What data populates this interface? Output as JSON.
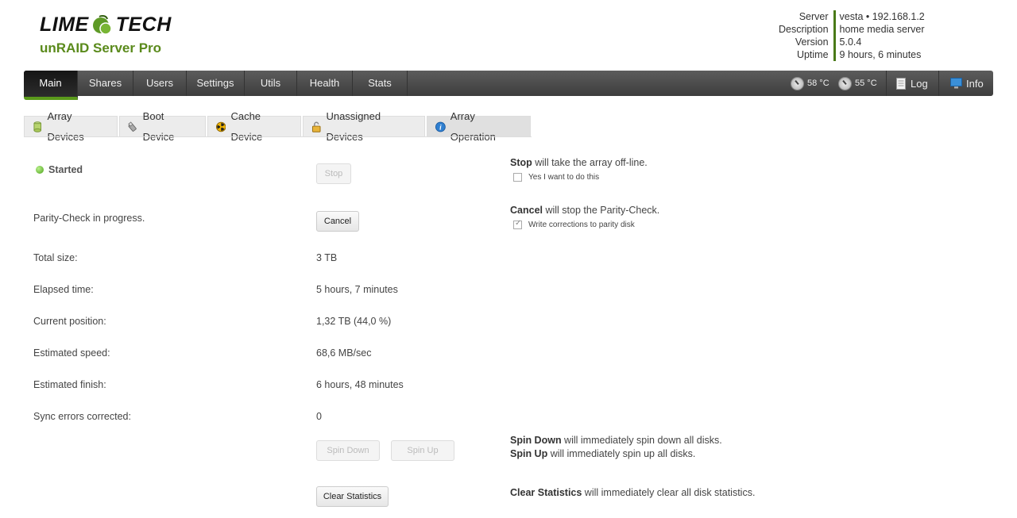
{
  "header": {
    "logo_left": "LIME",
    "logo_right": "TECH",
    "product": "unRAID Server Pro"
  },
  "server_info": {
    "labels": [
      "Server",
      "Description",
      "Version",
      "Uptime"
    ],
    "values": [
      "vesta • 192.168.1.2",
      "home media server",
      "5.0.4",
      "9 hours, 6 minutes"
    ]
  },
  "nav": {
    "items": [
      "Main",
      "Shares",
      "Users",
      "Settings",
      "Utils",
      "Health",
      "Stats"
    ],
    "temp1": "58 °C",
    "temp2": "55 °C",
    "log": "Log",
    "info": "Info"
  },
  "tabs": [
    "Array Devices",
    "Boot Device",
    "Cache Device",
    "Unassigned Devices",
    "Array Operation"
  ],
  "status": "Started",
  "stop_button": "Stop",
  "stop_desc_bold": "Stop",
  "stop_desc_rest": " will take the array off-line.",
  "stop_confirm": "Yes I want to do this",
  "parity_text": "Parity-Check in progress.",
  "cancel_button": "Cancel",
  "cancel_desc_bold": "Cancel",
  "cancel_desc_rest": " will stop the Parity-Check.",
  "write_corrections": "Write corrections to parity disk",
  "stats": {
    "total_size_label": "Total size:",
    "total_size": "3 TB",
    "elapsed_label": "Elapsed time:",
    "elapsed": "5 hours, 7 minutes",
    "position_label": "Current position:",
    "position": "1,32 TB (44,0 %)",
    "speed_label": "Estimated speed:",
    "speed": "68,6 MB/sec",
    "finish_label": "Estimated finish:",
    "finish": "6 hours, 48 minutes",
    "sync_label": "Sync errors corrected:",
    "sync": "0"
  },
  "spin_down_button": "Spin Down",
  "spin_up_button": "Spin Up",
  "spin_down_bold": "Spin Down",
  "spin_down_rest": " will immediately spin down all disks.",
  "spin_up_bold": "Spin Up",
  "spin_up_rest": " will immediately spin up all disks.",
  "clear_button": "Clear Statistics",
  "clear_bold": "Clear Statistics",
  "clear_rest": " will immediately clear all disk statistics.",
  "colors": {
    "accent_green": "#5a8a1b",
    "nav_bg": "#4a4a4a",
    "active_underline": "#5a9a1b"
  }
}
